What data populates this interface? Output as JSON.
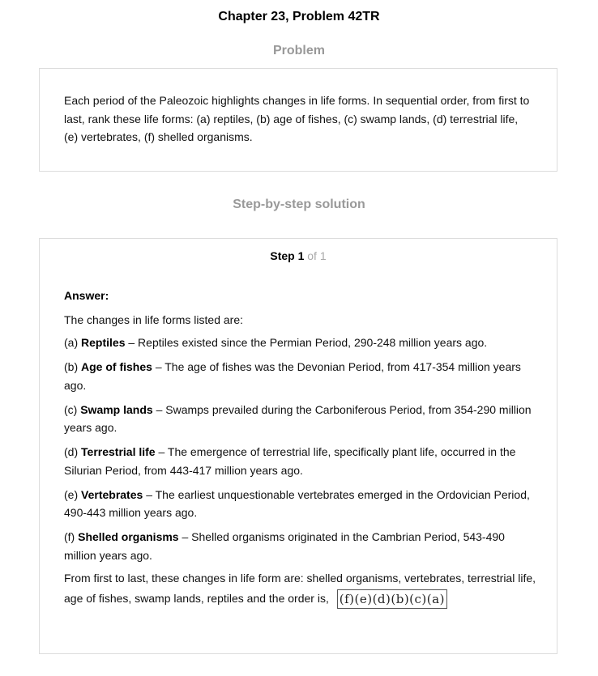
{
  "page": {
    "title": "Chapter 23, Problem 42TR"
  },
  "problem": {
    "heading": "Problem",
    "text": "Each period of the Paleozoic highlights changes in life forms. In sequential order, from first to last, rank these life forms: (a) reptiles, (b) age of fishes, (c) swamp lands, (d) terrestrial life, (e) vertebrates, (f) shelled organisms."
  },
  "solution": {
    "heading": "Step-by-step solution",
    "step": {
      "label": "Step 1",
      "of_label": "of 1"
    },
    "answer_label": "Answer:",
    "intro": "The changes in life forms listed are:",
    "entries": [
      {
        "letter": "(a)",
        "term": "Reptiles",
        "text": "– Reptiles existed since the Permian Period, 290-248 million years ago."
      },
      {
        "letter": "(b)",
        "term": "Age of fishes",
        "text": "– The age of fishes was the Devonian Period, from 417-354 million years ago."
      },
      {
        "letter": "(c)",
        "term": "Swamp lands",
        "text": "– Swamps prevailed during the Carboniferous Period, from 354-290 million years ago."
      },
      {
        "letter": "(d)",
        "term": "Terrestrial life",
        "text": "– The emergence of terrestrial life, specifically plant life, occurred in the Silurian Period, from 443-417 million years ago."
      },
      {
        "letter": "(e)",
        "term": "Vertebrates",
        "text": "– The earliest unquestionable vertebrates emerged in the Ordovician Period, 490-443 million years ago."
      },
      {
        "letter": "(f)",
        "term": "Shelled organisms",
        "text": "– Shelled organisms originated in the Cambrian Period, 543-490 million years ago."
      }
    ],
    "conclusion": "From first to last, these changes in life form are: shelled organisms, vertebrates, terrestrial life, age of fishes, swamp lands, reptiles and the order is,",
    "order": "(f)(e)(d)(b)(c)(a)"
  }
}
